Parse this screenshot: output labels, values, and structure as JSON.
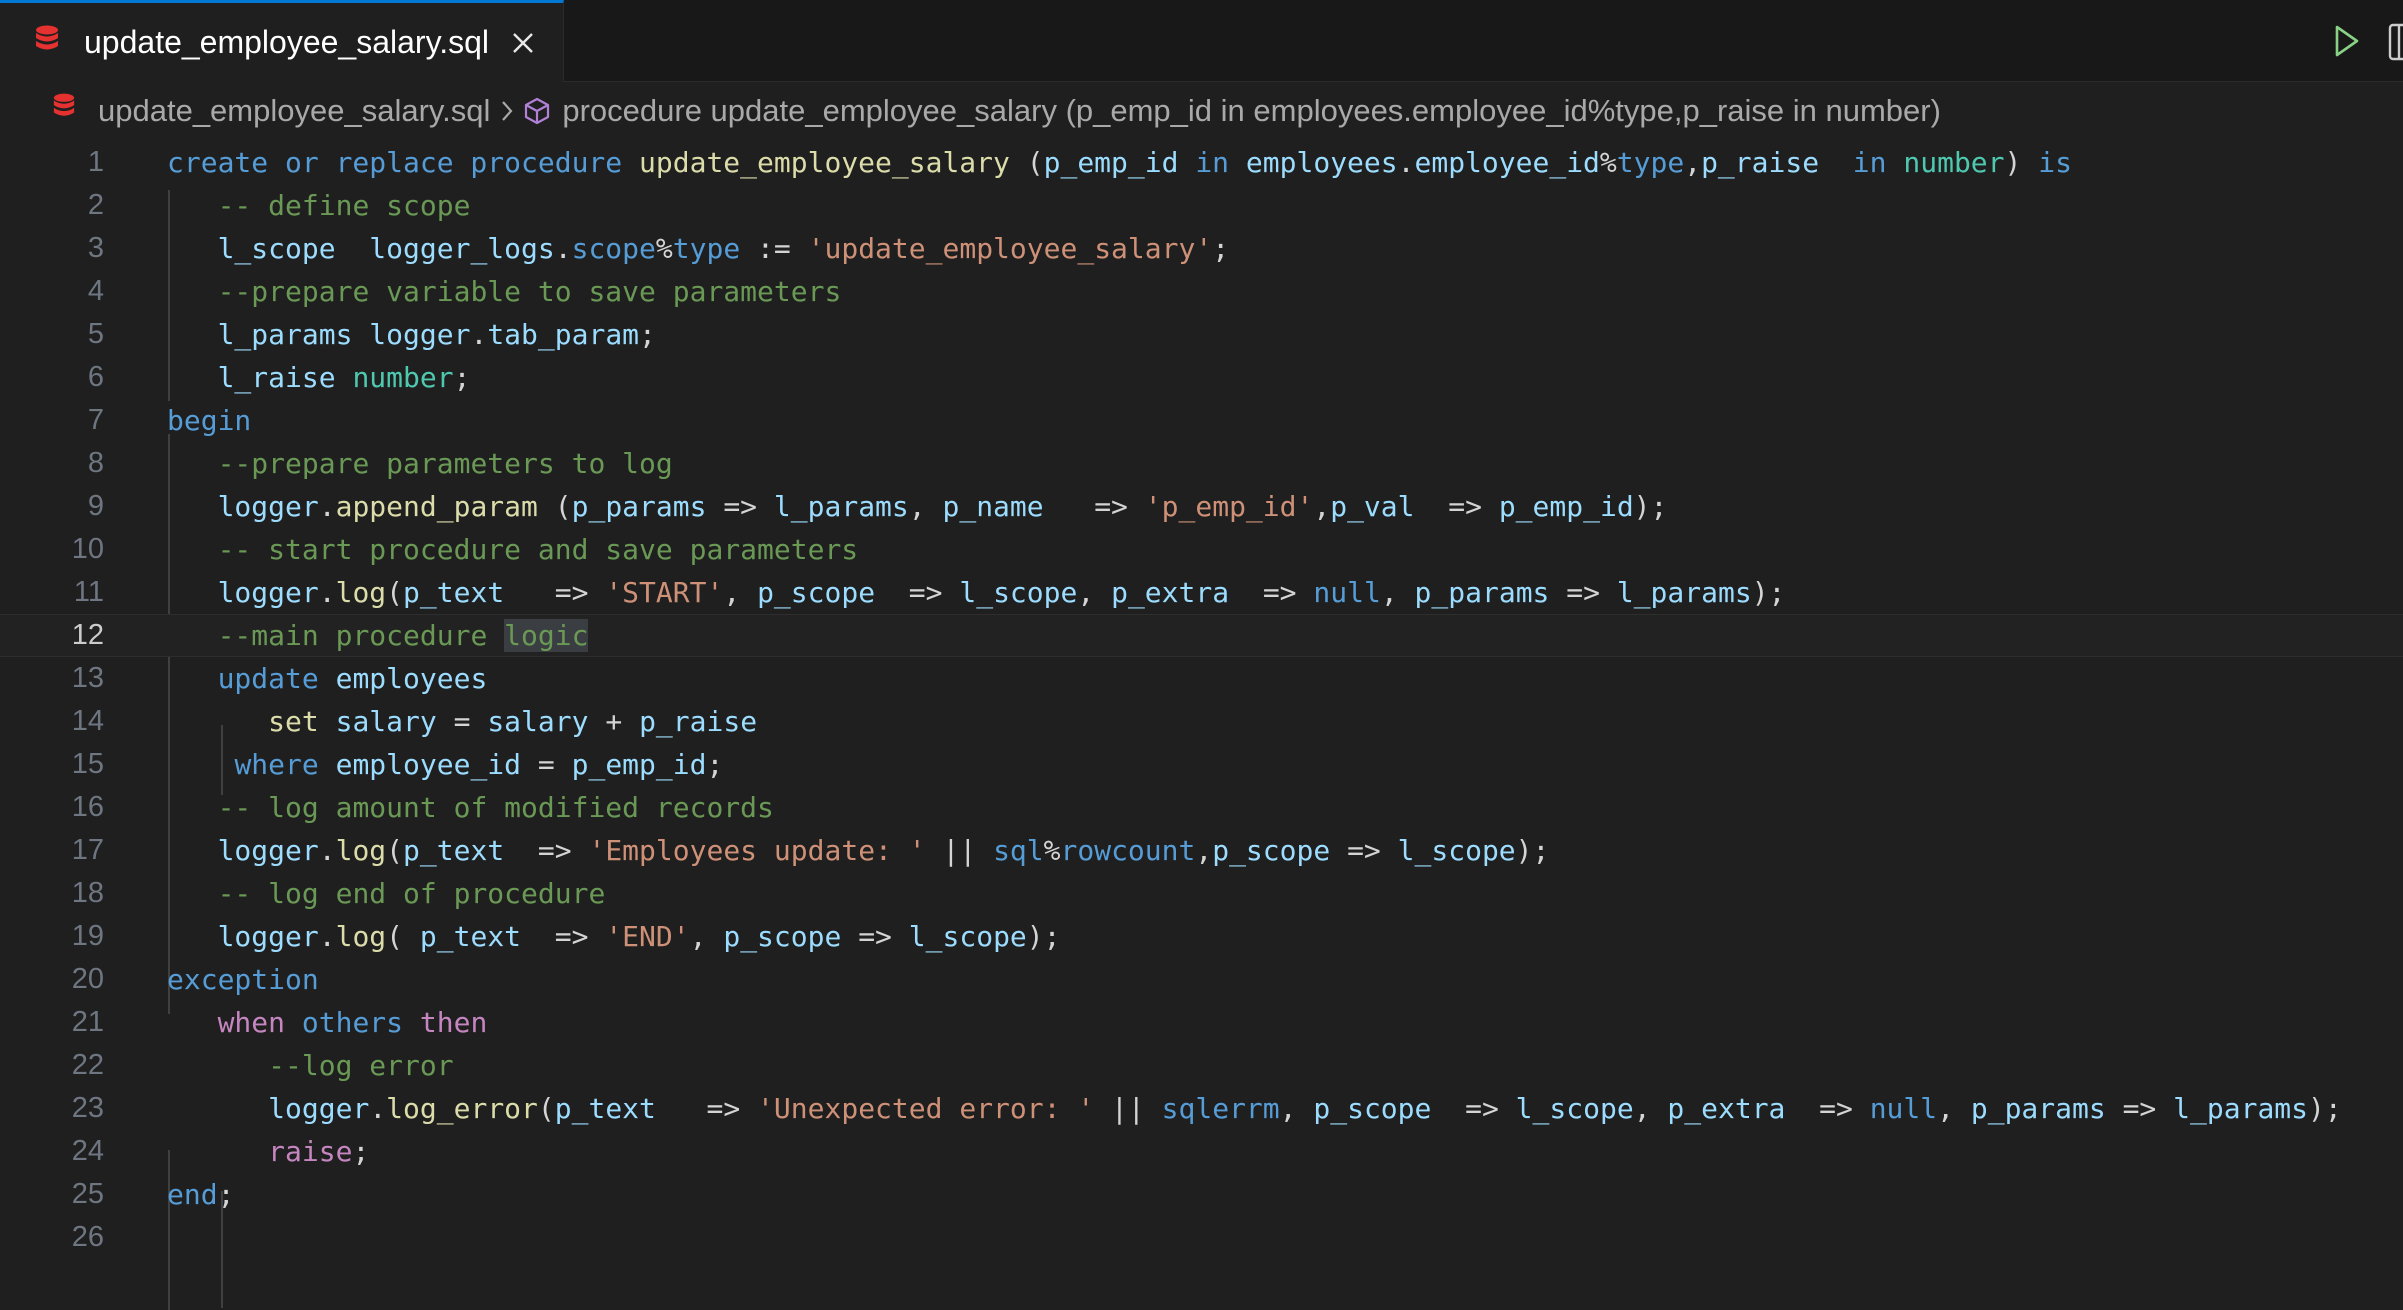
{
  "tab": {
    "title": "update_employee_salary.sql"
  },
  "breadcrumb": {
    "file": "update_employee_salary.sql",
    "symbol": "procedure update_employee_salary (p_emp_id in employees.employee_id%type,p_raise in number)"
  },
  "editor": {
    "current_line": 12,
    "lines": [
      {
        "n": "1",
        "tokens": [
          [
            "create or replace procedure ",
            "kw"
          ],
          [
            "update_employee_salary ",
            "fn"
          ],
          [
            "(",
            "op"
          ],
          [
            "p_emp_id ",
            "var"
          ],
          [
            "in ",
            "kw"
          ],
          [
            "employees",
            "var"
          ],
          [
            ".",
            "op"
          ],
          [
            "employee_id",
            "var"
          ],
          [
            "%",
            "op"
          ],
          [
            "type",
            "kw"
          ],
          [
            ",",
            "op"
          ],
          [
            "p_raise  ",
            "var"
          ],
          [
            "in ",
            "kw"
          ],
          [
            "number",
            "typ"
          ],
          [
            ") ",
            "op"
          ],
          [
            "is",
            "kw"
          ]
        ]
      },
      {
        "n": "2",
        "tokens": [
          [
            "   ",
            ""
          ],
          [
            "-- define scope",
            "com"
          ]
        ]
      },
      {
        "n": "3",
        "tokens": [
          [
            "   ",
            ""
          ],
          [
            "l_scope  ",
            "var"
          ],
          [
            "logger_logs",
            "var"
          ],
          [
            ".",
            "op"
          ],
          [
            "scope",
            "kw"
          ],
          [
            "%",
            "op"
          ],
          [
            "type",
            "kw"
          ],
          [
            " := ",
            "op"
          ],
          [
            "'update_employee_salary'",
            "str"
          ],
          [
            ";",
            "op"
          ]
        ]
      },
      {
        "n": "4",
        "tokens": [
          [
            "   ",
            ""
          ],
          [
            "--prepare variable to save parameters",
            "com"
          ]
        ]
      },
      {
        "n": "5",
        "tokens": [
          [
            "   ",
            ""
          ],
          [
            "l_params ",
            "var"
          ],
          [
            "logger",
            "var"
          ],
          [
            ".",
            "op"
          ],
          [
            "tab_param",
            "var"
          ],
          [
            ";",
            "op"
          ]
        ]
      },
      {
        "n": "6",
        "tokens": [
          [
            "   ",
            ""
          ],
          [
            "l_raise ",
            "var"
          ],
          [
            "number",
            "typ"
          ],
          [
            ";",
            "op"
          ]
        ]
      },
      {
        "n": "7",
        "tokens": [
          [
            "begin",
            "kw"
          ]
        ]
      },
      {
        "n": "8",
        "tokens": [
          [
            "   ",
            ""
          ],
          [
            "--prepare parameters to log",
            "com"
          ]
        ]
      },
      {
        "n": "9",
        "tokens": [
          [
            "   ",
            ""
          ],
          [
            "logger",
            "var"
          ],
          [
            ".",
            "op"
          ],
          [
            "append_param ",
            "fn"
          ],
          [
            "(",
            "op"
          ],
          [
            "p_params ",
            "var"
          ],
          [
            "=> ",
            "op"
          ],
          [
            "l_params",
            "var"
          ],
          [
            ", ",
            "op"
          ],
          [
            "p_name   ",
            "var"
          ],
          [
            "=> ",
            "op"
          ],
          [
            "'p_emp_id'",
            "str"
          ],
          [
            ",",
            "op"
          ],
          [
            "p_val  ",
            "var"
          ],
          [
            "=> ",
            "op"
          ],
          [
            "p_emp_id",
            "var"
          ],
          [
            ");",
            "op"
          ]
        ]
      },
      {
        "n": "10",
        "tokens": [
          [
            "   ",
            ""
          ],
          [
            "-- start procedure and save parameters",
            "com"
          ]
        ]
      },
      {
        "n": "11",
        "tokens": [
          [
            "   ",
            ""
          ],
          [
            "logger",
            "var"
          ],
          [
            ".",
            "op"
          ],
          [
            "log",
            "fn"
          ],
          [
            "(",
            "op"
          ],
          [
            "p_text   ",
            "var"
          ],
          [
            "=> ",
            "op"
          ],
          [
            "'START'",
            "str"
          ],
          [
            ", ",
            "op"
          ],
          [
            "p_scope  ",
            "var"
          ],
          [
            "=> ",
            "op"
          ],
          [
            "l_scope",
            "var"
          ],
          [
            ", ",
            "op"
          ],
          [
            "p_extra  ",
            "var"
          ],
          [
            "=> ",
            "op"
          ],
          [
            "null",
            "kw"
          ],
          [
            ", ",
            "op"
          ],
          [
            "p_params ",
            "var"
          ],
          [
            "=> ",
            "op"
          ],
          [
            "l_params",
            "var"
          ],
          [
            ");",
            "op"
          ]
        ]
      },
      {
        "n": "12",
        "tokens": [
          [
            "   ",
            ""
          ],
          [
            "--main procedure ",
            "com"
          ],
          [
            "logic",
            "com hl"
          ]
        ]
      },
      {
        "n": "13",
        "tokens": [
          [
            "   ",
            ""
          ],
          [
            "update ",
            "kw"
          ],
          [
            "employees",
            "var"
          ]
        ]
      },
      {
        "n": "14",
        "tokens": [
          [
            "      ",
            ""
          ],
          [
            "set ",
            "fn"
          ],
          [
            "salary ",
            "var"
          ],
          [
            "= ",
            "op"
          ],
          [
            "salary ",
            "var"
          ],
          [
            "+ ",
            "op"
          ],
          [
            "p_raise",
            "var"
          ]
        ]
      },
      {
        "n": "15",
        "tokens": [
          [
            "    ",
            ""
          ],
          [
            "where ",
            "kw"
          ],
          [
            "employee_id ",
            "var"
          ],
          [
            "= ",
            "op"
          ],
          [
            "p_emp_id",
            "var"
          ],
          [
            ";",
            "op"
          ]
        ]
      },
      {
        "n": "16",
        "tokens": [
          [
            "   ",
            ""
          ],
          [
            "-- log amount of modified records",
            "com"
          ]
        ]
      },
      {
        "n": "17",
        "tokens": [
          [
            "   ",
            ""
          ],
          [
            "logger",
            "var"
          ],
          [
            ".",
            "op"
          ],
          [
            "log",
            "fn"
          ],
          [
            "(",
            "op"
          ],
          [
            "p_text  ",
            "var"
          ],
          [
            "=> ",
            "op"
          ],
          [
            "'Employees update: '",
            "str"
          ],
          [
            " || ",
            "op"
          ],
          [
            "sql",
            "kw"
          ],
          [
            "%",
            "op"
          ],
          [
            "rowcount",
            "kw"
          ],
          [
            ",",
            "op"
          ],
          [
            "p_scope ",
            "var"
          ],
          [
            "=> ",
            "op"
          ],
          [
            "l_scope",
            "var"
          ],
          [
            ");",
            "op"
          ]
        ]
      },
      {
        "n": "18",
        "tokens": [
          [
            "   ",
            ""
          ],
          [
            "-- log end of procedure",
            "com"
          ]
        ]
      },
      {
        "n": "19",
        "tokens": [
          [
            "   ",
            ""
          ],
          [
            "logger",
            "var"
          ],
          [
            ".",
            "op"
          ],
          [
            "log",
            "fn"
          ],
          [
            "( ",
            "op"
          ],
          [
            "p_text  ",
            "var"
          ],
          [
            "=> ",
            "op"
          ],
          [
            "'END'",
            "str"
          ],
          [
            ", ",
            "op"
          ],
          [
            "p_scope ",
            "var"
          ],
          [
            "=> ",
            "op"
          ],
          [
            "l_scope",
            "var"
          ],
          [
            ");",
            "op"
          ]
        ]
      },
      {
        "n": "20",
        "tokens": [
          [
            "exception",
            "kw"
          ]
        ]
      },
      {
        "n": "21",
        "tokens": [
          [
            "   ",
            ""
          ],
          [
            "when ",
            "ctl"
          ],
          [
            "others ",
            "kw"
          ],
          [
            "then",
            "ctl"
          ]
        ]
      },
      {
        "n": "22",
        "tokens": [
          [
            "      ",
            ""
          ],
          [
            "--log error",
            "com"
          ]
        ]
      },
      {
        "n": "23",
        "tokens": [
          [
            "      ",
            ""
          ],
          [
            "logger",
            "var"
          ],
          [
            ".",
            "op"
          ],
          [
            "log_error",
            "fn"
          ],
          [
            "(",
            "op"
          ],
          [
            "p_text   ",
            "var"
          ],
          [
            "=> ",
            "op"
          ],
          [
            "'Unexpected error: '",
            "str"
          ],
          [
            " || ",
            "op"
          ],
          [
            "sqlerrm",
            "kw"
          ],
          [
            ", ",
            "op"
          ],
          [
            "p_scope  ",
            "var"
          ],
          [
            "=> ",
            "op"
          ],
          [
            "l_scope",
            "var"
          ],
          [
            ", ",
            "op"
          ],
          [
            "p_extra  ",
            "var"
          ],
          [
            "=> ",
            "op"
          ],
          [
            "null",
            "kw"
          ],
          [
            ", ",
            "op"
          ],
          [
            "p_params ",
            "var"
          ],
          [
            "=> ",
            "op"
          ],
          [
            "l_params",
            "var"
          ],
          [
            ");",
            "op"
          ]
        ]
      },
      {
        "n": "24",
        "tokens": [
          [
            "      ",
            ""
          ],
          [
            "raise",
            "ctl"
          ],
          [
            ";",
            "op"
          ]
        ]
      },
      {
        "n": "25",
        "tokens": [
          [
            "end",
            "kw"
          ],
          [
            ";",
            "op"
          ]
        ]
      },
      {
        "n": "26",
        "tokens": []
      }
    ]
  }
}
